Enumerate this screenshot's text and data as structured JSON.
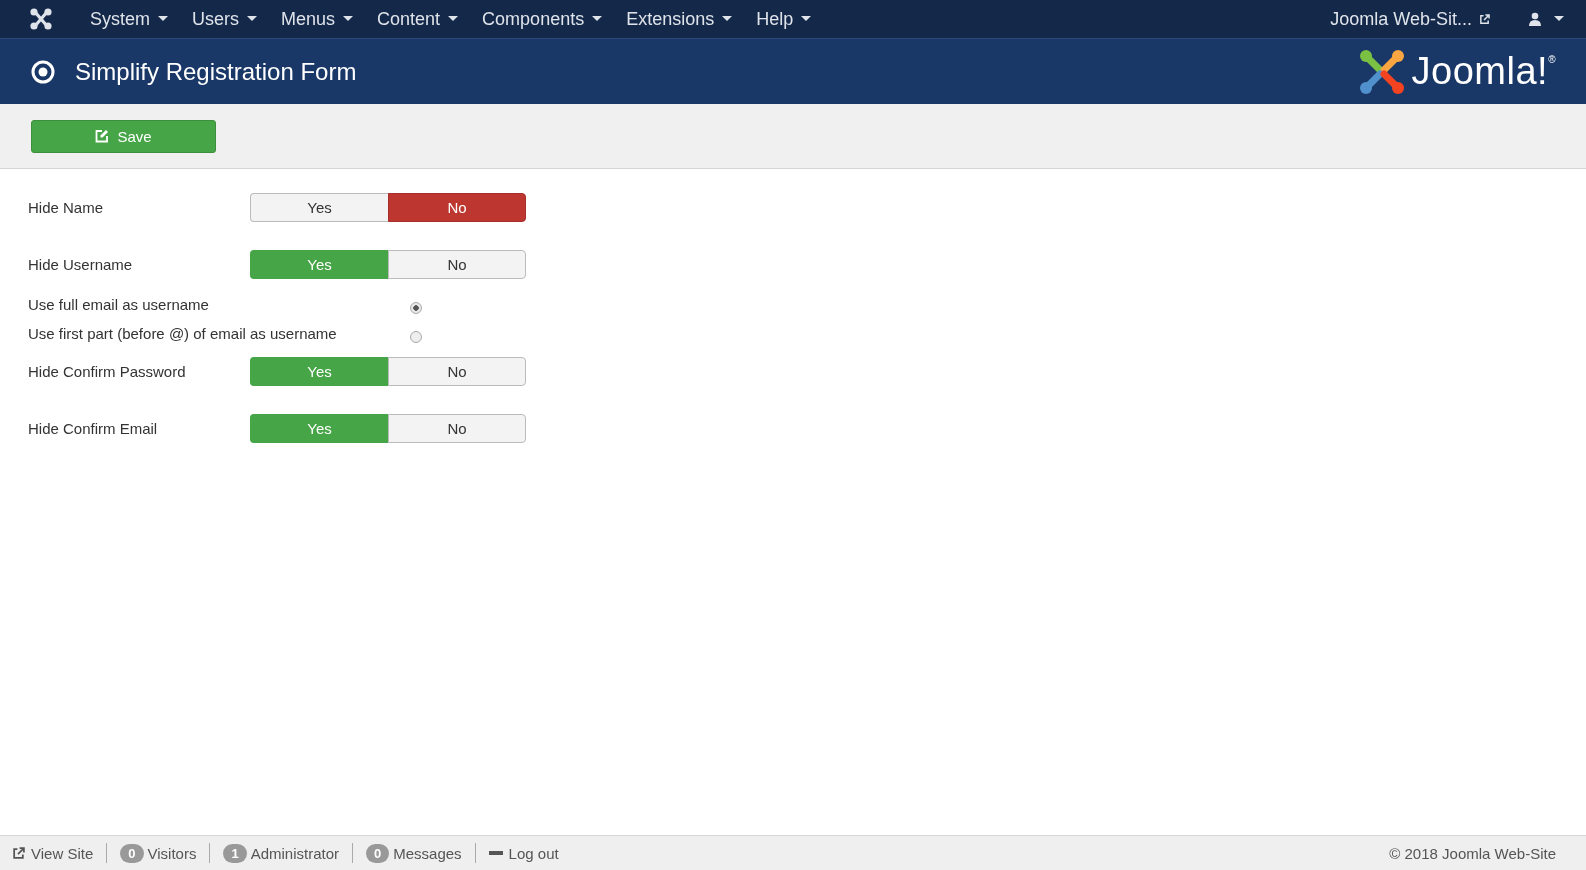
{
  "navbar": {
    "menu": [
      {
        "label": "System"
      },
      {
        "label": "Users"
      },
      {
        "label": "Menus"
      },
      {
        "label": "Content"
      },
      {
        "label": "Components"
      },
      {
        "label": "Extensions"
      },
      {
        "label": "Help"
      }
    ],
    "site_link": "Joomla Web-Sit..."
  },
  "header": {
    "title": "Simplify Registration Form",
    "logo_text": "Joomla!$^{®}$"
  },
  "toolbar": {
    "buttons": [
      {
        "label": "Save"
      }
    ]
  },
  "form": [
    {
      "kind": "toggle",
      "label": "Hide Name",
      "options": [
        {
          "label": "Yes",
          "selected": false
        },
        {
          "label": "No",
          "selected": true
        }
      ]
    },
    {
      "kind": "toggle",
      "label": "Hide Username",
      "options": [
        {
          "label": "Yes",
          "selected": true
        },
        {
          "label": "No",
          "selected": false
        }
      ]
    },
    {
      "kind": "radio",
      "label": "Use full email as username",
      "selected": true
    },
    {
      "kind": "radio",
      "label": "Use first part (before @) of email as username",
      "selected": false
    },
    {
      "kind": "toggle",
      "label": "Hide Confirm Password",
      "options": [
        {
          "label": "Yes",
          "selected": true
        },
        {
          "label": "No",
          "selected": false
        }
      ]
    },
    {
      "kind": "toggle",
      "label": "Hide Confirm Email",
      "options": [
        {
          "label": "Yes",
          "selected": true
        },
        {
          "label": "No",
          "selected": false
        }
      ]
    }
  ],
  "status_bar": {
    "items": [
      {
        "kind": "link",
        "label": "View Site"
      },
      {
        "kind": "count",
        "count": "0",
        "label": "Visitors"
      },
      {
        "kind": "count",
        "count": "1",
        "label": "Administrator"
      },
      {
        "kind": "count",
        "count": "0",
        "label": "Messages"
      },
      {
        "kind": "logout",
        "label": "Log out"
      }
    ],
    "copyright": "© 2018 Joomla Web-Site"
  }
}
